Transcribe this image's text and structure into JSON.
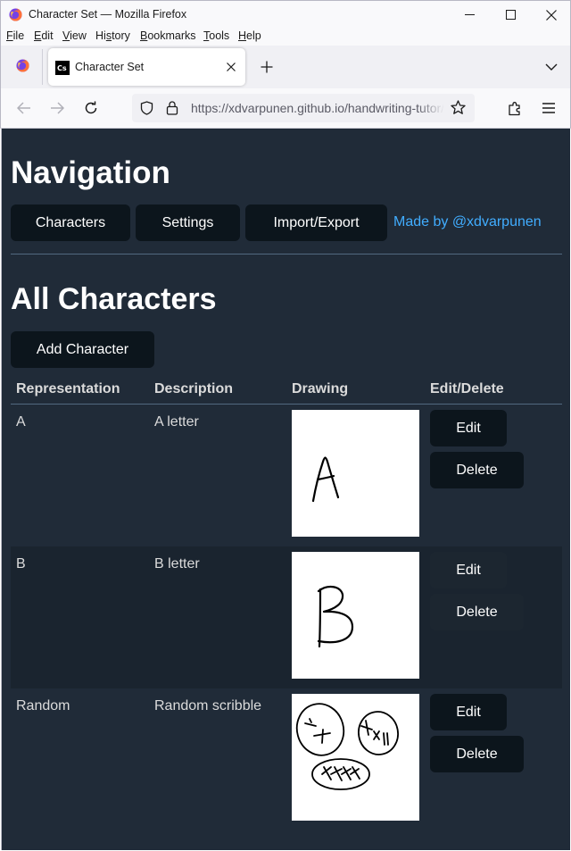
{
  "window": {
    "title": "Character Set — Mozilla Firefox"
  },
  "menubar": {
    "items": [
      {
        "accel": "F",
        "rest": "ile"
      },
      {
        "accel": "E",
        "rest": "dit"
      },
      {
        "accel": "V",
        "rest": "iew"
      },
      {
        "accel": "",
        "pre": "Hi",
        "mid": "s",
        "rest": "tory"
      },
      {
        "accel": "B",
        "rest": "ookmarks"
      },
      {
        "accel": "T",
        "rest": "ools"
      },
      {
        "accel": "H",
        "rest": "elp"
      }
    ]
  },
  "tabs": {
    "active_title": "Character Set",
    "favicon_text": "Cs"
  },
  "urlbar": {
    "url": "https://xdvarpunen.github.io/handwriting-tutor/"
  },
  "page": {
    "nav_heading": "Navigation",
    "nav_buttons": [
      "Characters",
      "Settings",
      "Import/Export"
    ],
    "made_by": "Made by @xdvarpunen",
    "section_heading": "All Characters",
    "add_button": "Add Character",
    "table_headers": [
      "Representation",
      "Description",
      "Drawing",
      "Edit/Delete"
    ],
    "rows": [
      {
        "representation": "A",
        "description": "A letter",
        "edit": "Edit",
        "delete": "Delete"
      },
      {
        "representation": "B",
        "description": "B letter",
        "edit": "Edit",
        "delete": "Delete"
      },
      {
        "representation": "Random",
        "description": "Random scribble",
        "edit": "Edit",
        "delete": "Delete"
      }
    ]
  },
  "colors": {
    "page_bg": "#202b38",
    "alt_row_bg": "#1a242f",
    "button_bg": "#0c151c",
    "link": "#41adff",
    "text": "#dbdbdb"
  }
}
